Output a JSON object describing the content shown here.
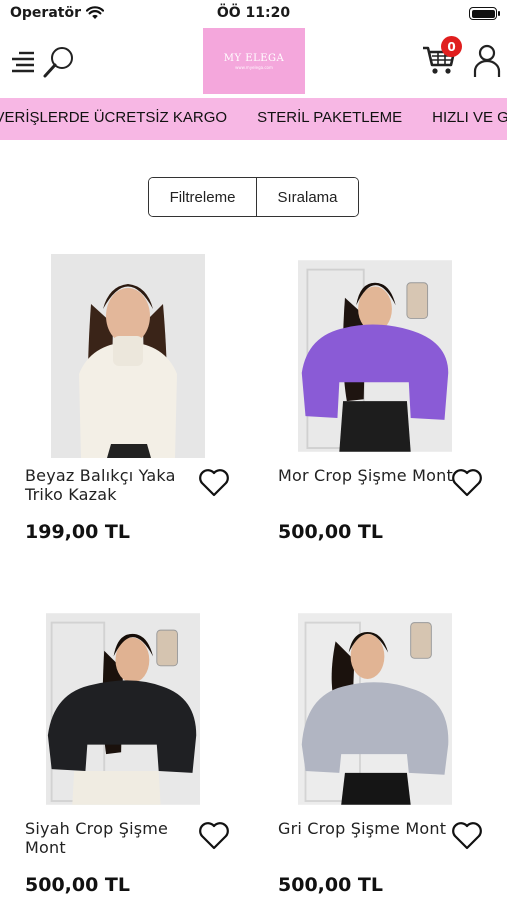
{
  "status_bar": {
    "carrier": "Operatör",
    "time": "ÖÖ 11:20"
  },
  "header": {
    "logo_text": "MY ELEGA",
    "logo_subtext": "www.myelega.com",
    "cart_count": "0",
    "accent_color": "#f4a7dc",
    "badge_color": "#e01e1e"
  },
  "announcement": {
    "items": [
      "ALIŞVERİŞLERDE ÜCRETSİZ KARGO",
      "STERİL PAKETLEME",
      "HIZLI VE GÜVENLİ"
    ],
    "background": "#f7b7e4"
  },
  "controls": {
    "filter_label": "Filtreleme",
    "sort_label": "Sıralama"
  },
  "products": [
    {
      "title": "Beyaz Balıkçı Yaka Triko Kazak",
      "price": "199,00 TL",
      "image": "woman-white-knit-sweater"
    },
    {
      "title": "Mor Crop Şişme Mont",
      "price": "500,00 TL",
      "image": "woman-purple-puffer-jacket"
    },
    {
      "title": "Siyah Crop Şişme Mont",
      "price": "500,00 TL",
      "image": "woman-black-puffer-jacket"
    },
    {
      "title": "Gri Crop Şişme Mont",
      "price": "500,00 TL",
      "image": "woman-grey-puffer-jacket"
    }
  ]
}
